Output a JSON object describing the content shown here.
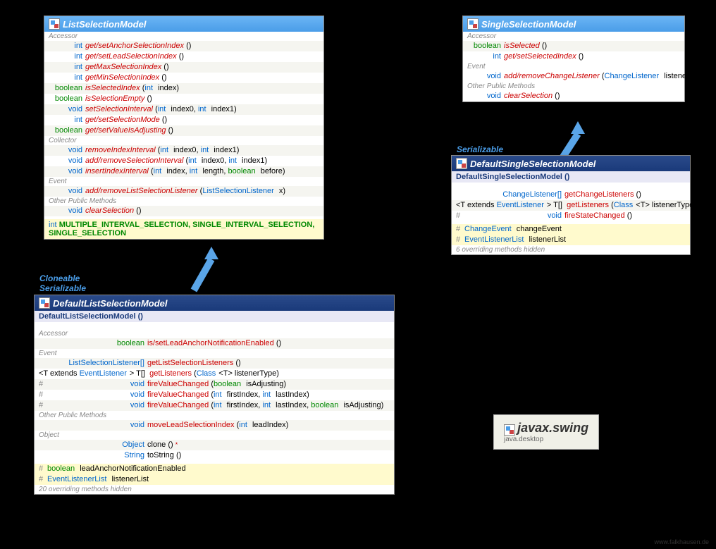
{
  "lsm": {
    "title": "ListSelectionModel",
    "accessor": "Accessor",
    "collector": "Collector",
    "event": "Event",
    "other": "Other Public Methods",
    "rows": [
      {
        "t": "int",
        "m": "get/setAnchorSelectionIndex",
        "p": "()"
      },
      {
        "t": "int",
        "m": "get/setLeadSelectionIndex",
        "p": "()"
      },
      {
        "t": "int",
        "m": "getMaxSelectionIndex",
        "p": "()"
      },
      {
        "t": "int",
        "m": "getMinSelectionIndex",
        "p": "()"
      },
      {
        "t": "boolean",
        "m": "isSelectedIndex",
        "p": "(int index)"
      },
      {
        "t": "boolean",
        "m": "isSelectionEmpty",
        "p": "()"
      },
      {
        "t": "void",
        "m": "setSelectionInterval",
        "p": "(int index0, int index1)"
      },
      {
        "t": "int",
        "m": "get/setSelectionMode",
        "p": "()"
      },
      {
        "t": "boolean",
        "m": "get/setValueIsAdjusting",
        "p": "()"
      }
    ],
    "crows": [
      {
        "t": "void",
        "m": "removeIndexInterval",
        "p": "(int index0, int index1)"
      },
      {
        "t": "void",
        "m": "add/removeSelectionInterval",
        "p": "(int index0, int index1)"
      },
      {
        "t": "void",
        "m": "insertIndexInterval",
        "p": "(int index, int length, boolean before)"
      }
    ],
    "erows": [
      {
        "t": "void",
        "m": "add/removeListSelectionListener",
        "p": "(ListSelectionListener x)"
      }
    ],
    "orows": [
      {
        "t": "void",
        "m": "clearSelection",
        "p": "()"
      }
    ],
    "const_pre": "int",
    "const": "MULTIPLE_INTERVAL_SELECTION, SINGLE_INTERVAL_SELECTION, SINGLE_SELECTION"
  },
  "dlsm": {
    "title": "DefaultListSelectionModel",
    "ctor": "DefaultListSelectionModel ()",
    "accessor": "Accessor",
    "event": "Event",
    "other": "Other Public Methods",
    "object": "Object",
    "arow": {
      "t": "boolean",
      "m": "is/setLeadAnchorNotificationEnabled",
      "p": "()"
    },
    "erows": [
      {
        "t": "ListSelectionListener[]",
        "m": "getListSelectionListeners",
        "p": "()"
      },
      {
        "pre": "<T extends EventListener> T[]",
        "m": "getListeners",
        "p": "(Class<T> listenerType)"
      },
      {
        "prot": "#",
        "t": "void",
        "m": "fireValueChanged",
        "p": "(boolean isAdjusting)"
      },
      {
        "prot": "#",
        "t": "void",
        "m": "fireValueChanged",
        "p": "(int firstIndex, int lastIndex)"
      },
      {
        "prot": "#",
        "t": "void",
        "m": "fireValueChanged",
        "p": "(int firstIndex, int lastIndex, boolean isAdjusting)"
      }
    ],
    "orow": {
      "t": "void",
      "m": "moveLeadSelectionIndex",
      "p": "(int leadIndex)"
    },
    "objrows": [
      {
        "t": "Object",
        "m": "clone",
        "p": "() ",
        "star": "*"
      },
      {
        "t": "String",
        "m": "toString",
        "p": "()"
      }
    ],
    "flds": [
      {
        "prot": "#",
        "t": "boolean",
        "n": "leadAnchorNotificationEnabled"
      },
      {
        "prot": "#",
        "t": "EventListenerList",
        "n": "listenerList"
      }
    ],
    "hidden": "20 overriding methods hidden"
  },
  "ssm": {
    "title": "SingleSelectionModel",
    "accessor": "Accessor",
    "event": "Event",
    "other": "Other Public Methods",
    "arows": [
      {
        "t": "boolean",
        "m": "isSelected",
        "p": "()"
      },
      {
        "t": "int",
        "m": "get/setSelectedIndex",
        "p": "()"
      }
    ],
    "erow": {
      "t": "void",
      "m": "add/removeChangeListener",
      "p": "(ChangeListener listener)"
    },
    "orow": {
      "t": "void",
      "m": "clearSelection",
      "p": "()"
    }
  },
  "dssm": {
    "title": "DefaultSingleSelectionModel",
    "ctor": "DefaultSingleSelectionModel ()",
    "rows": [
      {
        "t": "ChangeListener[]",
        "m": "getChangeListeners",
        "p": "()"
      },
      {
        "pre": "<T extends EventListener> T[]",
        "m": "getListeners",
        "p": "(Class<T> listenerType)"
      },
      {
        "prot": "#",
        "t": "void",
        "m": "fireStateChanged",
        "p": "()"
      }
    ],
    "flds": [
      {
        "prot": "#",
        "t": "ChangeEvent",
        "n": "changeEvent"
      },
      {
        "prot": "#",
        "t": "EventListenerList",
        "n": "listenerList"
      }
    ],
    "hidden": "6 overriding methods hidden"
  },
  "tags": {
    "cloneable": "Cloneable",
    "serializable": "Serializable",
    "serializable2": "Serializable"
  },
  "pkg": {
    "name": "javax.swing",
    "sub": "java.desktop"
  },
  "footer": "www.falkhausen.de"
}
